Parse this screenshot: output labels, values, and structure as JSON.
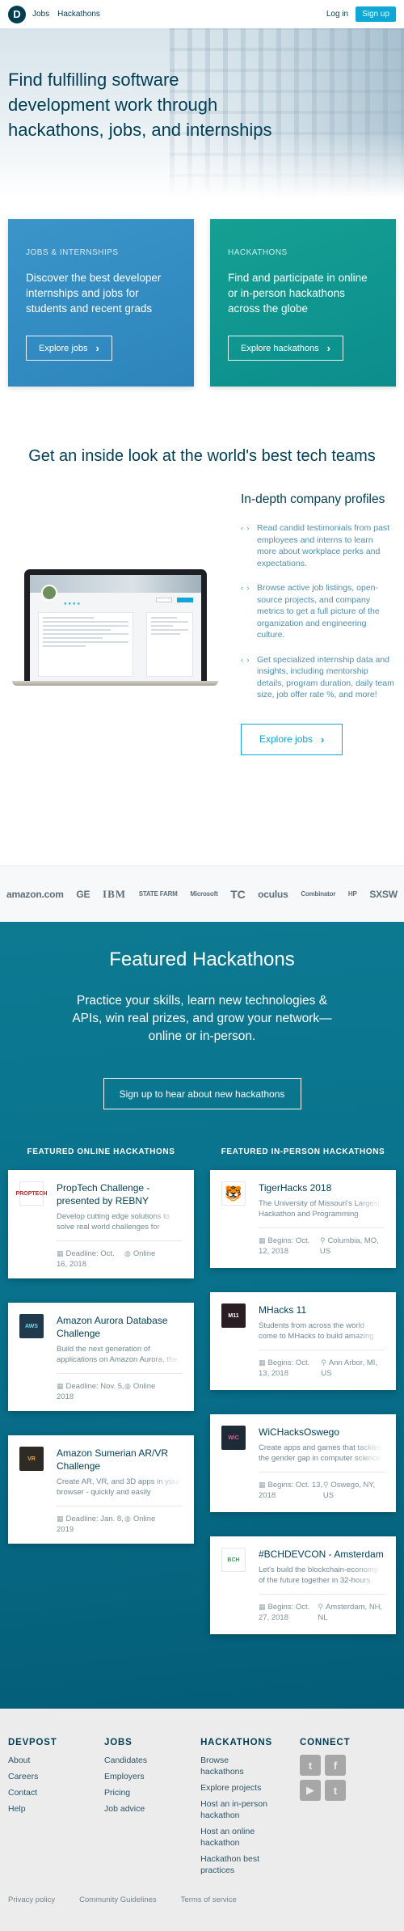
{
  "header": {
    "logo_letter": "D",
    "nav": [
      "Jobs",
      "Hackathons"
    ],
    "login": "Log in",
    "signup": "Sign up"
  },
  "hero": {
    "title": "Find fulfilling software development work through hackathons, jobs, and internships"
  },
  "cards": {
    "jobs": {
      "kicker": "JOBS & INTERNSHIPS",
      "text": "Discover the best developer internships and jobs for students and recent grads",
      "button": "Explore jobs"
    },
    "hackathons": {
      "kicker": "HACKATHONS",
      "text": "Find and participate in online or in-person hackathons across the globe",
      "button": "Explore hackathons"
    }
  },
  "inside": {
    "title": "Get an inside look at the world's best tech teams",
    "heading": "In-depth company profiles",
    "bullets": [
      "Read candid testimonials from past employees and interns to learn more about workplace perks and expectations.",
      "Browse active job listings, open-source projects, and company metrics to get a full picture of the organization and engineering culture.",
      "Get specialized internship data and insights, including mentorship details, program duration, daily team size, job offer rate %, and more!"
    ],
    "button": "Explore jobs"
  },
  "logos": [
    "amazon.com",
    "GE",
    "IBM",
    "STATE FARM",
    "Microsoft",
    "TC",
    "oculus",
    "Combinator",
    "HP",
    "SXSW"
  ],
  "featured": {
    "title": "Featured Hackathons",
    "subtitle": "Practice your skills, learn new technologies & APIs, win real prizes, and grow your network—online or in-person.",
    "signup_button": "Sign up to hear about new hackathons",
    "online": {
      "title": "FEATURED ONLINE HACKATHONS",
      "items": [
        {
          "title": "PropTech Challenge - presented by REBNY",
          "desc": "Develop cutting edge solutions to solve real world challenges for NYC's",
          "date": "Deadline: Oct. 16, 2018",
          "location": "Online",
          "thumb": "PROPTECH",
          "thumb_bg": "#ffffff",
          "thumb_fg": "#c0272d"
        },
        {
          "title": "Amazon Aurora Database Challenge",
          "desc": "Build the next generation of applications on Amazon Aurora, the",
          "date": "Deadline: Nov. 5, 2018",
          "location": "Online",
          "thumb": "AWS",
          "thumb_bg": "#1f3a4d",
          "thumb_fg": "#7fd3e6"
        },
        {
          "title": "Amazon Sumerian AR/VR Challenge",
          "desc": "Create AR, VR, and 3D apps in your browser - quickly and easily",
          "date": "Deadline: Jan. 8, 2019",
          "location": "Online",
          "thumb": "VR",
          "thumb_bg": "#2e2b25",
          "thumb_fg": "#f0a830"
        }
      ]
    },
    "inperson": {
      "title": "FEATURED IN-PERSON HACKATHONS",
      "items": [
        {
          "title": "TigerHacks 2018",
          "desc": "The University of Missouri's Largest Hackathon and Programming",
          "date": "Begins: Oct. 12, 2018",
          "location": "Columbia, MO, US",
          "thumb": "🐯",
          "thumb_bg": "#ffffff",
          "thumb_fg": "#e0892a"
        },
        {
          "title": "MHacks 11",
          "desc": "Students from across the world come to MHacks to build amazing things",
          "date": "Begins: Oct. 13, 2018",
          "location": "Ann Arbor, MI, US",
          "thumb": "M11",
          "thumb_bg": "#2a1d24",
          "thumb_fg": "#ffffff"
        },
        {
          "title": "WiCHacksOswego",
          "desc": "Create apps and games that tackles the gender gap in computer science",
          "date": "Begins: Oct. 13, 2018",
          "location": "Oswego, NY, US",
          "thumb": "WiC",
          "thumb_bg": "#1d2b36",
          "thumb_fg": "#e05a9a"
        },
        {
          "title": "#BCHDEVCON - Amsterdam",
          "desc": "Let's build the blockchain-economy of the future together in 32-hours",
          "date": "Begins: Oct. 27, 2018",
          "location": "Amsterdam, NH, NL",
          "thumb": "BCH",
          "thumb_bg": "#ffffff",
          "thumb_fg": "#3aa25f"
        }
      ]
    }
  },
  "footer": {
    "devpost": {
      "title": "DEVPOST",
      "links": [
        "About",
        "Careers",
        "Contact",
        "Help"
      ]
    },
    "jobs": {
      "title": "JOBS",
      "links": [
        "Candidates",
        "Employers",
        "Pricing",
        "Job advice"
      ]
    },
    "hackathons": {
      "title": "HACKATHONS",
      "links": [
        "Browse hackathons",
        "Explore projects",
        "Host an in-person hackathon",
        "Host an online hackathon",
        "Hackathon best practices"
      ]
    },
    "connect": {
      "title": "CONNECT",
      "icons": [
        "twitter-icon",
        "facebook-icon",
        "youtube-icon",
        "tumblr-icon"
      ]
    },
    "bottom": [
      "Privacy policy",
      "Community Guidelines",
      "Terms of service"
    ]
  },
  "colors": {
    "navy": "#003e54",
    "accent": "#0fa8d6",
    "jobs_card": "#3391c7",
    "hack_card": "#119893",
    "featured_bg": "#0a7590"
  }
}
